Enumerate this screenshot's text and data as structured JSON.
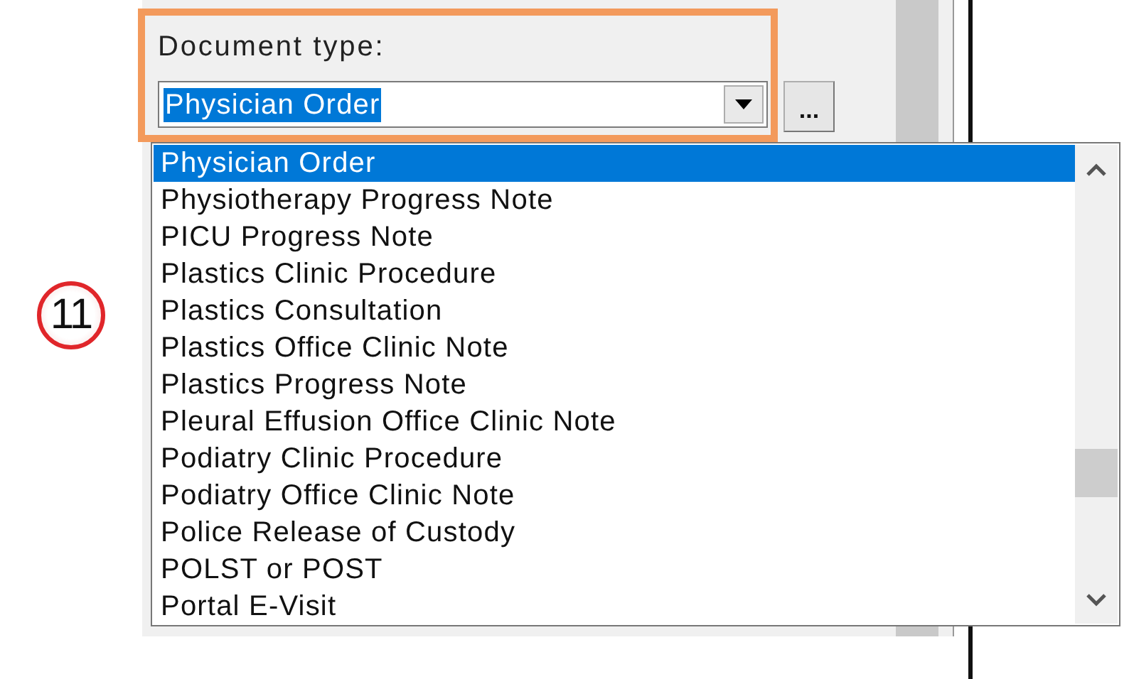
{
  "step_badge": "11",
  "document_type": {
    "label": "Document type:",
    "value": "Physician Order",
    "browse_button": "..."
  },
  "dropdown": {
    "items": [
      {
        "label": "Physician Order",
        "selected": true
      },
      {
        "label": "Physiotherapy Progress Note",
        "selected": false
      },
      {
        "label": "PICU Progress Note",
        "selected": false
      },
      {
        "label": "Plastics Clinic Procedure",
        "selected": false
      },
      {
        "label": "Plastics Consultation",
        "selected": false
      },
      {
        "label": "Plastics Office Clinic Note",
        "selected": false
      },
      {
        "label": "Plastics Progress Note",
        "selected": false
      },
      {
        "label": "Pleural Effusion Office Clinic Note",
        "selected": false
      },
      {
        "label": "Podiatry Clinic Procedure",
        "selected": false
      },
      {
        "label": "Podiatry Office Clinic Note",
        "selected": false
      },
      {
        "label": "Police Release of Custody",
        "selected": false
      },
      {
        "label": "POLST or POST",
        "selected": false
      },
      {
        "label": "Portal E-Visit",
        "selected": false
      }
    ]
  }
}
